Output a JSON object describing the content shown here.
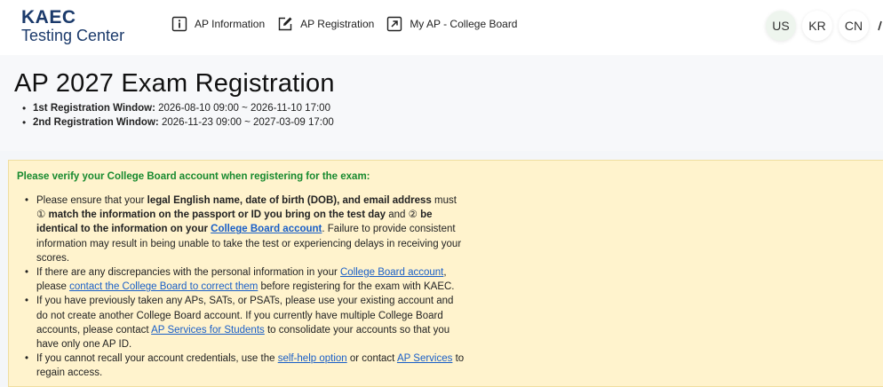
{
  "logo": {
    "line1": "KAEC",
    "line2": "Testing Center"
  },
  "nav": [
    {
      "label": "AP Information",
      "icon": "info-icon"
    },
    {
      "label": "AP Registration",
      "icon": "edit-icon"
    },
    {
      "label": "My AP - College Board",
      "icon": "external-link-icon"
    }
  ],
  "languages": {
    "us": "US",
    "kr": "KR",
    "cn": "CN",
    "active": "US"
  },
  "page": {
    "title": "AP 2027 Exam Registration",
    "window1": {
      "label": "1st Registration Window:",
      "value": "2026-08-10 09:00 ~ 2026-11-10 17:00"
    },
    "window2": {
      "label": "2nd Registration Window:",
      "value": "2026-11-23 09:00 ~ 2027-03-09 17:00"
    }
  },
  "notice": {
    "heading": "Please verify your College Board account when registering for the exam:",
    "b1": {
      "t1": "Please ensure that your ",
      "b1": "legal English name, date of birth (DOB), and email address",
      "t2": " must ① ",
      "b2": "match the information on the passport or ID you bring on the test day",
      "t3": " and ② ",
      "b3": "be identical to the information on your ",
      "link": "College Board account",
      "t4": ". Failure to provide consistent information may result in being unable to take the test or experiencing delays in receiving your scores."
    },
    "b2": {
      "t1": "If there are any discrepancies with the personal information in your ",
      "link1": "College Board account",
      "t2": ", please ",
      "link2": "contact the College Board to correct them",
      "t3": " before registering for the exam with KAEC."
    },
    "b3": {
      "t1": "If you have previously taken any APs, SATs, or PSATs, please use your existing account and do not create another College Board account. If you currently have multiple College Board accounts, please contact ",
      "link": "AP Services for Students",
      "t2": " to consolidate your accounts so that you have only one AP ID."
    },
    "b4": {
      "t1": "If you cannot recall your account credentials, use the ",
      "link1": "self-help option",
      "t2": " or contact ",
      "link2": "AP Services",
      "t3": " to regain access."
    }
  },
  "colors": {
    "brand": "#1b3a6b",
    "heading_green": "#188a2f",
    "notice_bg": "#fff3cd",
    "link": "#1a5fc7"
  }
}
